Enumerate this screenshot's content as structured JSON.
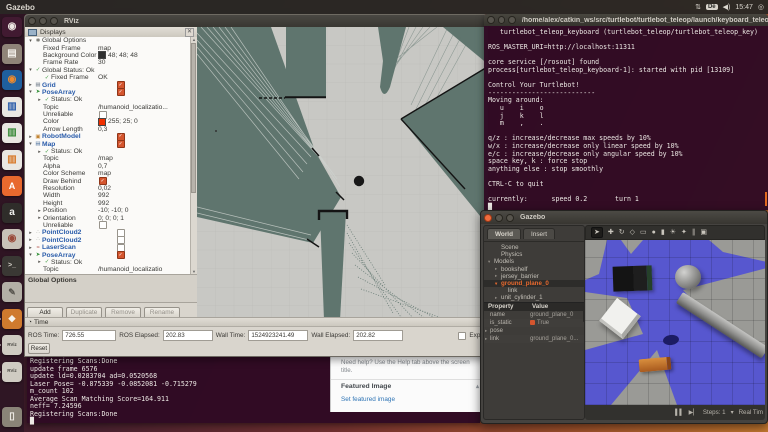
{
  "colors": {
    "accent": "#e8692e",
    "aubergine": "#300a24",
    "map_free": "#c8c8c4",
    "map_unknown": "#5f756e",
    "ground_blue": "#5757cf",
    "rviz_blue": "#2a5caa",
    "check_orange": "#d4552e"
  },
  "menubar": {
    "app_title": "Gazebo",
    "keyboard_indicator": "De",
    "clock": "15:47",
    "network_icon": "updown-arrows",
    "volume_icon": "speaker",
    "power_icon": "power-gear"
  },
  "launcher": {
    "items": [
      {
        "name": "dash-home",
        "glyph": "◉",
        "bg": "#411a31",
        "fg": "#ece8e2"
      },
      {
        "name": "files",
        "glyph": "▤",
        "bg": "#8f8478",
        "fg": "#efece6"
      },
      {
        "name": "firefox",
        "glyph": "◉",
        "bg": "#1f5f9e",
        "fg": "#ef8a2c"
      },
      {
        "name": "libreoffice-writer",
        "glyph": "▥",
        "bg": "#e9e7e2",
        "fg": "#2a5caa"
      },
      {
        "name": "libreoffice-calc",
        "glyph": "▥",
        "bg": "#e9e7e2",
        "fg": "#3a8a3a"
      },
      {
        "name": "libreoffice-impress",
        "glyph": "▥",
        "bg": "#e9e7e2",
        "fg": "#d87a2a"
      },
      {
        "name": "ubuntu-software",
        "glyph": "A",
        "bg": "#e8692e",
        "fg": "#ffffff",
        "fs": 9
      },
      {
        "name": "amazon",
        "glyph": "a",
        "bg": "#2f2d2a",
        "fg": "#f0f0ee",
        "fs": 10
      },
      {
        "name": "system-settings",
        "glyph": "◉",
        "bg": "#c8c2b8",
        "fg": "#9a4a3a"
      },
      {
        "name": "terminal",
        "glyph": ">_",
        "bg": "#3a3834",
        "fg": "#d8d4cc",
        "fs": 7,
        "pip": true
      },
      {
        "name": "text-editor",
        "glyph": "✎",
        "bg": "#b3afa6",
        "fg": "#55524c",
        "fs": 9
      },
      {
        "name": "gazebo",
        "glyph": "◆",
        "bg": "#cf7a2e",
        "fg": "#f6f2ea",
        "fs": 9,
        "pip": true
      },
      {
        "name": "rviz-1",
        "glyph": "RViz",
        "bg": "#cfcbc2",
        "fg": "#4a4843",
        "fs": 4.5,
        "pip": true
      },
      {
        "name": "rviz-2",
        "glyph": "RViz",
        "bg": "#cfcbc2",
        "fg": "#4a4843",
        "fs": 4.5,
        "pip": true
      }
    ],
    "trash": {
      "name": "trash",
      "glyph": "▯",
      "bg": "#8a8478",
      "fg": "#efece6"
    }
  },
  "rviz": {
    "window_title": "RViz",
    "displays_panel": {
      "title": "Displays",
      "close_glyph": "✕",
      "rows": [
        {
          "a": "▾",
          "ic": "gear",
          "lb": "Global Options",
          "ind": 0
        },
        {
          "lb": "Fixed Frame",
          "v": "map",
          "ind": 1
        },
        {
          "lb": "Background Color",
          "v": "48; 48; 48",
          "sw": "#303030",
          "ind": 1
        },
        {
          "lb": "Frame Rate",
          "v": "30",
          "ind": 1
        },
        {
          "a": "▾",
          "ic": "check",
          "lb": "Global Status: Ok",
          "ind": 0
        },
        {
          "ic": "check",
          "lb": "Fixed Frame",
          "v": "OK",
          "ind": 1
        },
        {
          "a": "▸",
          "ic": "grid",
          "lb": "Grid",
          "b": 1,
          "cb": 1,
          "ind": 0
        },
        {
          "a": "▾",
          "ic": "pose",
          "lb": "PoseArray",
          "b": 1,
          "cb": 1,
          "ind": 0
        },
        {
          "a": "▸",
          "ic": "check",
          "lb": "Status: Ok",
          "ind": 1
        },
        {
          "lb": "Topic",
          "v": "/humanoid_localizatio...",
          "ind": 1
        },
        {
          "lb": "Unreliable",
          "cb": 0,
          "ind": 1
        },
        {
          "lb": "Color",
          "v": "255; 25; 0",
          "sw": "#f03000",
          "ind": 1
        },
        {
          "lb": "Arrow Length",
          "v": "0,3",
          "ind": 1
        },
        {
          "a": "▸",
          "ic": "robot",
          "lb": "RobotModel",
          "b": 1,
          "cb": 1,
          "ind": 0
        },
        {
          "a": "▾",
          "ic": "map",
          "lb": "Map",
          "b": 1,
          "cb": 1,
          "ind": 0
        },
        {
          "a": "▸",
          "ic": "check",
          "lb": "Status: Ok",
          "ind": 1
        },
        {
          "lb": "Topic",
          "v": "/map",
          "ind": 1
        },
        {
          "lb": "Alpha",
          "v": "0,7",
          "ind": 1
        },
        {
          "lb": "Color Scheme",
          "v": "map",
          "ind": 1
        },
        {
          "lb": "Draw Behind",
          "cb": 1,
          "ind": 1
        },
        {
          "lb": "Resolution",
          "v": "0,02",
          "ind": 1
        },
        {
          "lb": "Width",
          "v": "992",
          "ind": 1
        },
        {
          "lb": "Height",
          "v": "992",
          "ind": 1
        },
        {
          "a": "▸",
          "lb": "Position",
          "v": "-10; -10; 0",
          "ind": 1
        },
        {
          "a": "▸",
          "lb": "Orientation",
          "v": "0; 0; 0; 1",
          "ind": 1
        },
        {
          "lb": "Unreliable",
          "cb": 0,
          "ind": 1
        },
        {
          "a": "▸",
          "ic": "cloud",
          "lb": "PointCloud2",
          "b": 1,
          "cb": 0,
          "ind": 0
        },
        {
          "a": "▸",
          "ic": "cloud",
          "lb": "PointCloud2",
          "b": 1,
          "cb": 0,
          "ind": 0
        },
        {
          "a": "▸",
          "ic": "laser",
          "lb": "LaserScan",
          "b": 1,
          "cb": 0,
          "ind": 0
        },
        {
          "a": "▾",
          "ic": "pose",
          "lb": "PoseArray",
          "b": 1,
          "cb": 1,
          "ind": 0
        },
        {
          "a": "▸",
          "ic": "check",
          "lb": "Status: Ok",
          "ind": 1
        },
        {
          "lb": "Topic",
          "v": "/humanoid_localizatio",
          "ind": 1
        }
      ],
      "help_text": "Global Options",
      "buttons": [
        "Add",
        "Duplicate",
        "Remove",
        "Rename"
      ]
    },
    "time_panel": {
      "title": "Time",
      "fields": [
        {
          "label": "ROS Time:",
          "value": "726.55"
        },
        {
          "label": "ROS Elapsed:",
          "value": "202.83"
        },
        {
          "label": "Wall Time:",
          "value": "1524923241.49"
        },
        {
          "label": "Wall Elapsed:",
          "value": "202.82"
        }
      ],
      "experimental_label": "Expe",
      "reset_label": "Reset"
    }
  },
  "teleop_terminal": {
    "title": "/home/alex/catkin_ws/src/turtlebot/turtlebot_teleop/launch/keyboard_teleop.lau",
    "lines": [
      "   turtlebot_teleop_keyboard (turtlebot_teleop/turtlebot_teleop_key)",
      "",
      "ROS_MASTER_URI=http://localhost:11311",
      "",
      "core service [/rosout] found",
      "process[turtlebot_teleop_keyboard-1]: started with pid [13109]",
      "",
      "Control Your Turtlebot!",
      "---------------------------",
      "Moving around:",
      "   u    i    o",
      "   j    k    l",
      "   m    ,    .",
      "",
      "q/z : increase/decrease max speeds by 10%",
      "w/x : increase/decrease only linear speed by 10%",
      "e/c : increase/decrease only angular speed by 10%",
      "space key, k : force stop",
      "anything else : stop smoothly",
      "",
      "CTRL-C to quit",
      "",
      "currently:      speed 0.2       turn 1",
      "█"
    ]
  },
  "gmapping_terminal": {
    "lines": [
      "Registering Scans:Done",
      "update frame 6576",
      "update ld=0.0283704 ad=0.0520568",
      "Laser Pose= -0.875339 -0.0852081 -0.715279",
      "m_count 102",
      "Average Scan Matching Score=164.911",
      "neff= 7.24596",
      "Registering Scans:Done",
      "█"
    ]
  },
  "webpage": {
    "help_text": "Need help? Use the Help tab above the screen title.",
    "featured_image_label": "Featured Image",
    "collapse_glyph": "▴",
    "set_featured_link": "Set featured image"
  },
  "gazebo": {
    "window_title": "Gazebo",
    "tabs": [
      "World",
      "Insert"
    ],
    "tree": [
      {
        "lb": "Scene",
        "ind": 1
      },
      {
        "lb": "Physics",
        "ind": 1
      },
      {
        "a": "▾",
        "lb": "Models",
        "ind": 0
      },
      {
        "a": "▸",
        "lb": "bookshelf",
        "ind": 1
      },
      {
        "a": "▸",
        "lb": "jersey_barrier",
        "ind": 1
      },
      {
        "a": "▾",
        "lb": "ground_plane_0",
        "ind": 1,
        "sel": 1
      },
      {
        "lb": "link",
        "ind": 2
      },
      {
        "a": "▸",
        "lb": "unit_cylinder_1",
        "ind": 1
      }
    ],
    "properties": {
      "headers": [
        "Property",
        "Value"
      ],
      "rows": [
        {
          "k": "name",
          "v": "ground_plane_0"
        },
        {
          "k": "is_static",
          "v": "True",
          "cb": 1
        },
        {
          "k": "pose",
          "v": "",
          "a": "▸"
        },
        {
          "k": "link",
          "v": "ground_plane_0...",
          "a": "▸"
        }
      ]
    },
    "toolbar": [
      {
        "n": "select-arrow-icon",
        "g": "➤",
        "sel": 1
      },
      {
        "n": "translate-icon",
        "g": "✚"
      },
      {
        "n": "rotate-icon",
        "g": "↻"
      },
      {
        "n": "scale-icon",
        "g": "◇"
      },
      {
        "n": "box-icon",
        "g": "▭"
      },
      {
        "n": "sphere-icon",
        "g": "●"
      },
      {
        "n": "cylinder-icon",
        "g": "▮"
      },
      {
        "n": "sun-icon",
        "g": "☀"
      },
      {
        "n": "spot-light-icon",
        "g": "✦"
      },
      {
        "n": "directional-light-icon",
        "g": "∥"
      },
      {
        "n": "camera-icon",
        "g": "▣"
      }
    ],
    "statusbar": {
      "pause_glyph": "▌▌",
      "step_glyph": "▶▏",
      "steps_label": "Steps: 1",
      "steps_caret": "▾",
      "realtime_label": "Real Tim"
    }
  }
}
